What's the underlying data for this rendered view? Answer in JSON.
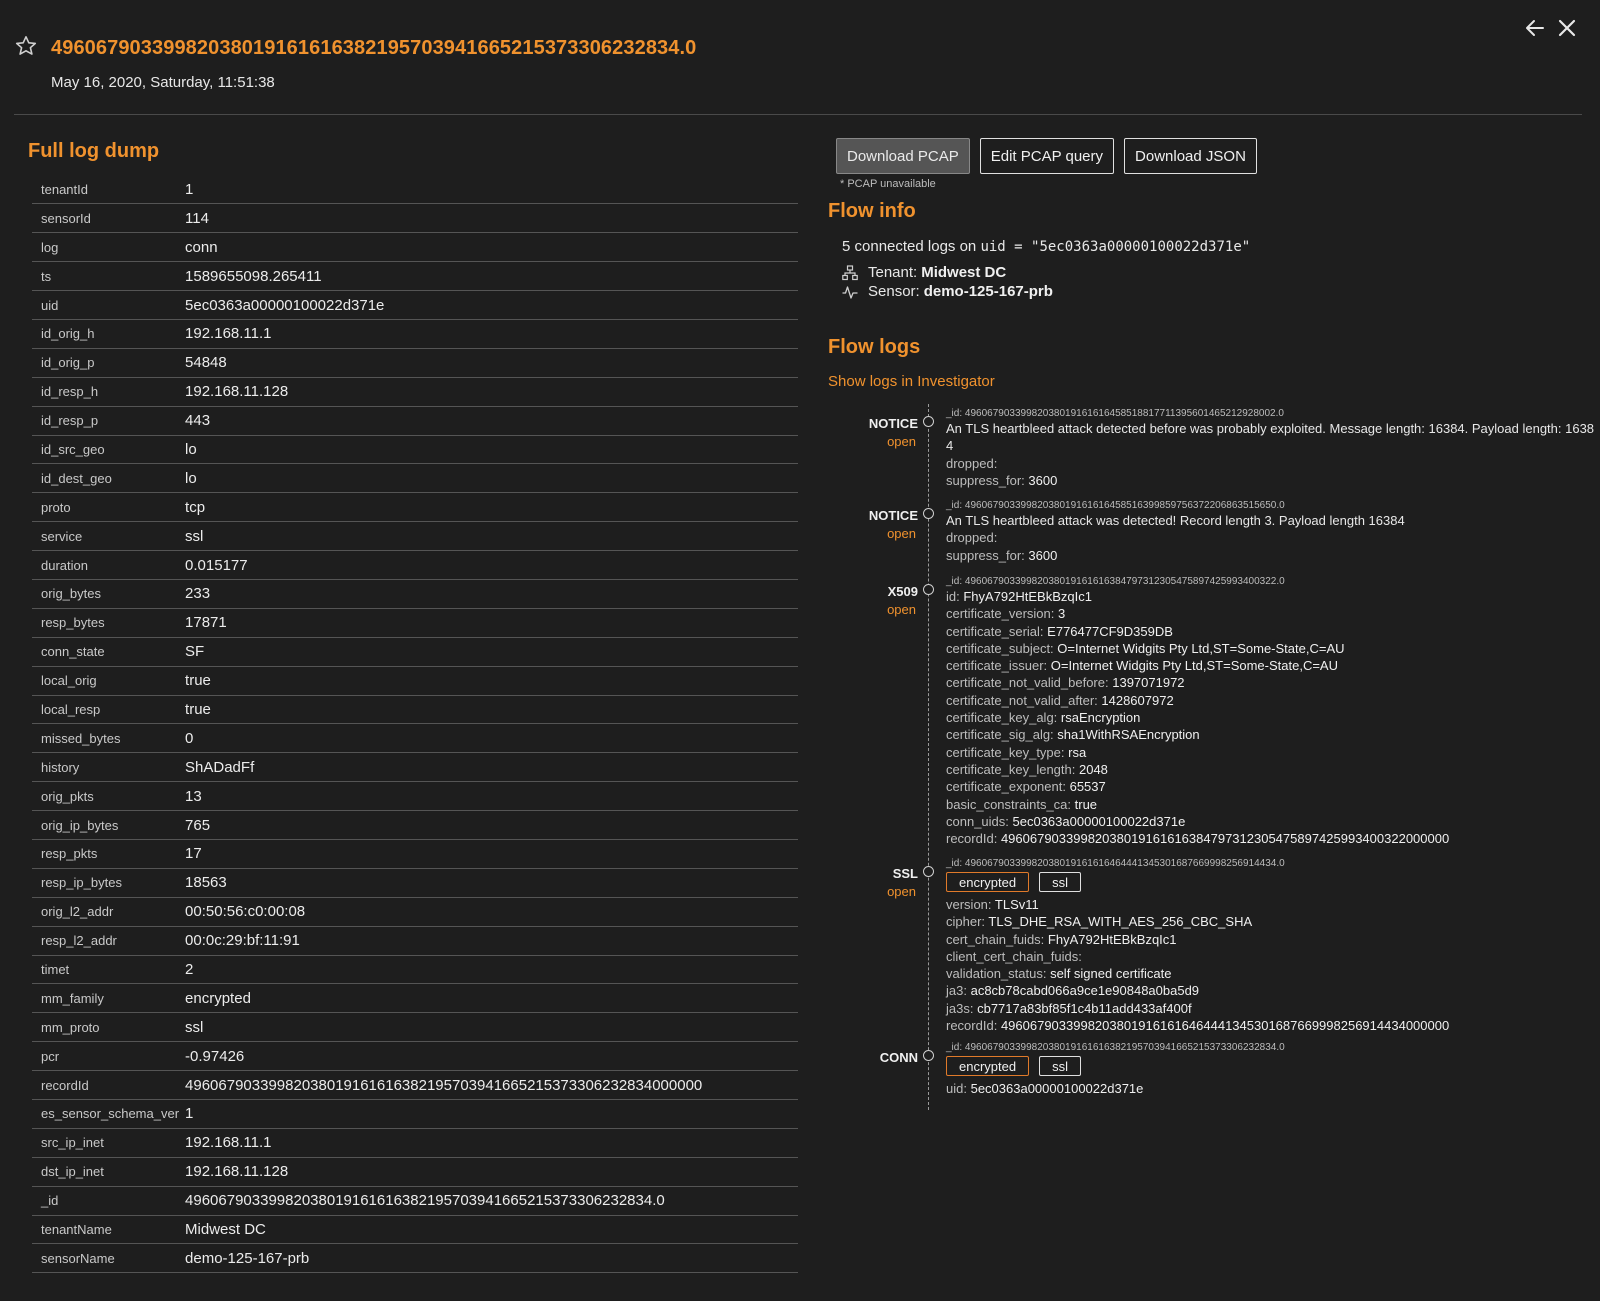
{
  "header": {
    "title": "4960679033998203801916161638219570394166521537330623283 4.0",
    "title_clean": "49606790339982038019161616382195703941665215373306232834.0",
    "subtitle": "May 16, 2020, Saturday, 11:51:38"
  },
  "dump": {
    "title": "Full log dump",
    "rows": [
      {
        "k": "tenantId",
        "v": "1"
      },
      {
        "k": "sensorId",
        "v": "114"
      },
      {
        "k": "log",
        "v": "conn"
      },
      {
        "k": "ts",
        "v": "1589655098.265411"
      },
      {
        "k": "uid",
        "v": "5ec0363a00000100022d371e"
      },
      {
        "k": "id_orig_h",
        "v": "192.168.11.1"
      },
      {
        "k": "id_orig_p",
        "v": "54848"
      },
      {
        "k": "id_resp_h",
        "v": "192.168.11.128"
      },
      {
        "k": "id_resp_p",
        "v": "443"
      },
      {
        "k": "id_src_geo",
        "v": "lo"
      },
      {
        "k": "id_dest_geo",
        "v": "lo"
      },
      {
        "k": "proto",
        "v": "tcp"
      },
      {
        "k": "service",
        "v": "ssl"
      },
      {
        "k": "duration",
        "v": "0.015177"
      },
      {
        "k": "orig_bytes",
        "v": "233"
      },
      {
        "k": "resp_bytes",
        "v": "17871"
      },
      {
        "k": "conn_state",
        "v": "SF"
      },
      {
        "k": "local_orig",
        "v": "true"
      },
      {
        "k": "local_resp",
        "v": "true"
      },
      {
        "k": "missed_bytes",
        "v": "0"
      },
      {
        "k": "history",
        "v": "ShADadFf"
      },
      {
        "k": "orig_pkts",
        "v": "13"
      },
      {
        "k": "orig_ip_bytes",
        "v": "765"
      },
      {
        "k": "resp_pkts",
        "v": "17"
      },
      {
        "k": "resp_ip_bytes",
        "v": "18563"
      },
      {
        "k": "orig_l2_addr",
        "v": "00:50:56:c0:00:08"
      },
      {
        "k": "resp_l2_addr",
        "v": "00:0c:29:bf:11:91"
      },
      {
        "k": "timet",
        "v": "2"
      },
      {
        "k": "mm_family",
        "v": "encrypted"
      },
      {
        "k": "mm_proto",
        "v": "ssl"
      },
      {
        "k": "pcr",
        "v": "-0.97426"
      },
      {
        "k": "recordId",
        "v": "49606790339982038019161616382195703941665215373306232834000000"
      },
      {
        "k": "es_sensor_schema_ver",
        "v": "1"
      },
      {
        "k": "src_ip_inet",
        "v": "192.168.11.1"
      },
      {
        "k": "dst_ip_inet",
        "v": "192.168.11.128"
      },
      {
        "k": "_id",
        "v": "49606790339982038019161616382195703941665215373306232834.0"
      },
      {
        "k": "tenantName",
        "v": "Midwest DC"
      },
      {
        "k": "sensorName",
        "v": "demo-125-167-prb"
      }
    ]
  },
  "toolbar": {
    "download_pcap": "Download PCAP",
    "edit_pcap": "Edit PCAP query",
    "download_json": "Download JSON",
    "pcap_note": "* PCAP unavailable"
  },
  "flow_info": {
    "title": "Flow info",
    "connected_prefix": "5 connected logs on",
    "connected_code": "uid = \"5ec0363a00000100022d371e\"",
    "tenant_label": "Tenant:",
    "tenant_value": "Midwest DC",
    "sensor_label": "Sensor:",
    "sensor_value": "demo-125-167-prb"
  },
  "flow_logs": {
    "title": "Flow logs",
    "link": "Show logs in Investigator",
    "entries": [
      {
        "type": "NOTICE",
        "status": "open",
        "id": "_id: 49606790339982038019161616458518817711395601465212928002.0",
        "lines": [
          {
            "t": "An TLS heartbleed attack detected before was probably exploited. Message length: 16384. Payload length: 16384"
          },
          {
            "k": "dropped:",
            "v": ""
          },
          {
            "k": "suppress_for:",
            "v": "3600"
          }
        ]
      },
      {
        "type": "NOTICE",
        "status": "open",
        "id": "_id: 49606790339982038019161616458516399859756372206863515650.0",
        "lines": [
          {
            "t": "An TLS heartbleed attack was detected! Record length 3. Payload length 16384"
          },
          {
            "k": "dropped:",
            "v": ""
          },
          {
            "k": "suppress_for:",
            "v": "3600"
          }
        ]
      },
      {
        "type": "X509",
        "status": "open",
        "id": "_id: 49606790339982038019161616384797312305475897425993400322.0",
        "lines": [
          {
            "k": "id:",
            "v": "FhyA792HtEBkBzqIc1"
          },
          {
            "k": "certificate_version:",
            "v": "3"
          },
          {
            "k": "certificate_serial:",
            "v": "E776477CF9D359DB"
          },
          {
            "k": "certificate_subject:",
            "v": "O=Internet Widgits Pty Ltd,ST=Some-State,C=AU"
          },
          {
            "k": "certificate_issuer:",
            "v": "O=Internet Widgits Pty Ltd,ST=Some-State,C=AU"
          },
          {
            "k": "certificate_not_valid_before:",
            "v": "1397071972"
          },
          {
            "k": "certificate_not_valid_after:",
            "v": "1428607972"
          },
          {
            "k": "certificate_key_alg:",
            "v": "rsaEncryption"
          },
          {
            "k": "certificate_sig_alg:",
            "v": "sha1WithRSAEncryption"
          },
          {
            "k": "certificate_key_type:",
            "v": "rsa"
          },
          {
            "k": "certificate_key_length:",
            "v": "2048"
          },
          {
            "k": "certificate_exponent:",
            "v": "65537"
          },
          {
            "k": "basic_constraints_ca:",
            "v": "true"
          },
          {
            "k": "conn_uids:",
            "v": "5ec0363a00000100022d371e"
          },
          {
            "k": "recordId:",
            "v": "49606790339982038019161616384797312305475897425993400322000000"
          }
        ]
      },
      {
        "type": "SSL",
        "status": "open",
        "id": "_id: 49606790339982038019161616464441345301687669998256914434.0",
        "tags": [
          "encrypted",
          "ssl"
        ],
        "lines": [
          {
            "k": "version:",
            "v": "TLSv11"
          },
          {
            "k": "cipher:",
            "v": "TLS_DHE_RSA_WITH_AES_256_CBC_SHA"
          },
          {
            "k": "cert_chain_fuids:",
            "v": "FhyA792HtEBkBzqIc1"
          },
          {
            "k": "client_cert_chain_fuids:",
            "v": ""
          },
          {
            "k": "validation_status:",
            "v": "self signed certificate"
          },
          {
            "k": "ja3:",
            "v": "ac8cb78cabd066a9ce1e90848a0ba5d9"
          },
          {
            "k": "ja3s:",
            "v": "cb7717a83bf85f1c4b11add433af400f"
          },
          {
            "k": "recordId:",
            "v": "49606790339982038019161616464441345301687669998256914434000000"
          }
        ]
      },
      {
        "type": "CONN",
        "status": "",
        "id": "_id: 49606790339982038019161616382195703941665215373306232834.0",
        "tags": [
          "encrypted",
          "ssl"
        ],
        "lines": [
          {
            "k": "uid:",
            "v": "5ec0363a00000100022d371e"
          }
        ]
      }
    ]
  },
  "colors": {
    "background": "#1e1e1e",
    "accent": "#f0922e",
    "text": "#e8e8e8"
  },
  "icons": [
    "star-icon",
    "back-arrow-icon",
    "close-icon",
    "network-icon",
    "pulse-icon"
  ]
}
